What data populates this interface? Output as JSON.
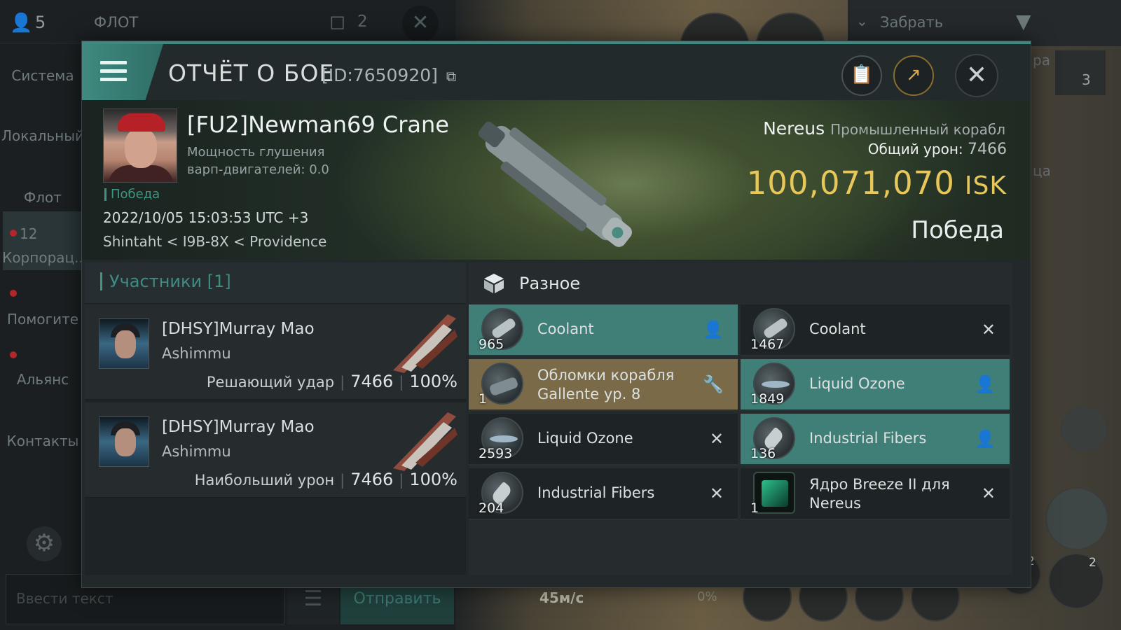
{
  "background": {
    "fleet_count": "5",
    "fleet_tab_label": "ФЛОТ",
    "fleet_windows": "2",
    "take_label": "Забрать",
    "side_partial_1": "ра",
    "side_partial_2": "ца",
    "side_count": "3",
    "chat_channels": [
      "Система",
      "Локальный",
      "Флот",
      "Корпорац..",
      "Помогите",
      "Альянс",
      "Контакты"
    ],
    "corp_unread": "12",
    "chat_placeholder": "Ввести текст",
    "send_label": "Отправить",
    "speed": "45м/с",
    "throttle": "0%",
    "module_count_1": "2",
    "module_count_2": "2"
  },
  "header": {
    "title": "ОТЧЁТ О БОЕ",
    "report_id": "[ID:7650920]"
  },
  "victim": {
    "name": "[FU2]Newman69 Crane",
    "jam_label": "Мощность глушения варп-двигателей: 0.0",
    "result_tag": "Победа",
    "datetime": "2022/10/05 15:03:53 UTC +3",
    "location": "Shintaht < I9B-8X < Providence",
    "ship": "Nereus",
    "ship_class": "Промышленный корабл",
    "total_damage_label": "Общий урон:",
    "total_damage": "7466",
    "isk_value": "100,071,070",
    "isk_currency": "ISK",
    "result": "Победа"
  },
  "participants": {
    "title": "Участники [1]",
    "list": [
      {
        "name": "[DHSY]Murray Mao",
        "ship": "Ashimmu",
        "role": "Решающий удар",
        "damage": "7466",
        "percent": "100%"
      },
      {
        "name": "[DHSY]Murray Mao",
        "ship": "Ashimmu",
        "role": "Наибольший урон",
        "damage": "7466",
        "percent": "100%"
      }
    ]
  },
  "items": {
    "title": "Разное",
    "list": [
      {
        "qty": "965",
        "name": "Coolant",
        "status": "dropped",
        "icon": "coolant-icon"
      },
      {
        "qty": "1467",
        "name": "Coolant",
        "status": "destroyed",
        "icon": "coolant-icon"
      },
      {
        "qty": "1",
        "name": "Обломки корабля Gallente ур. 8",
        "status": "fitted",
        "icon": "wreck-icon"
      },
      {
        "qty": "1849",
        "name": "Liquid Ozone",
        "status": "dropped",
        "icon": "ozone-icon"
      },
      {
        "qty": "2593",
        "name": "Liquid Ozone",
        "status": "destroyed",
        "icon": "ozone-icon"
      },
      {
        "qty": "136",
        "name": "Industrial Fibers",
        "status": "dropped",
        "icon": "fibers-icon"
      },
      {
        "qty": "204",
        "name": "Industrial Fibers",
        "status": "destroyed",
        "icon": "fibers-icon"
      },
      {
        "qty": "1",
        "name": "Ядро Breeze II для Nereus",
        "status": "destroyed",
        "icon": "core-icon"
      }
    ]
  },
  "colors": {
    "accent": "#3f8a80",
    "isk": "#e7c75a",
    "dropped_bg": "#3f7f77",
    "fitted_bg": "#7a6a47"
  }
}
